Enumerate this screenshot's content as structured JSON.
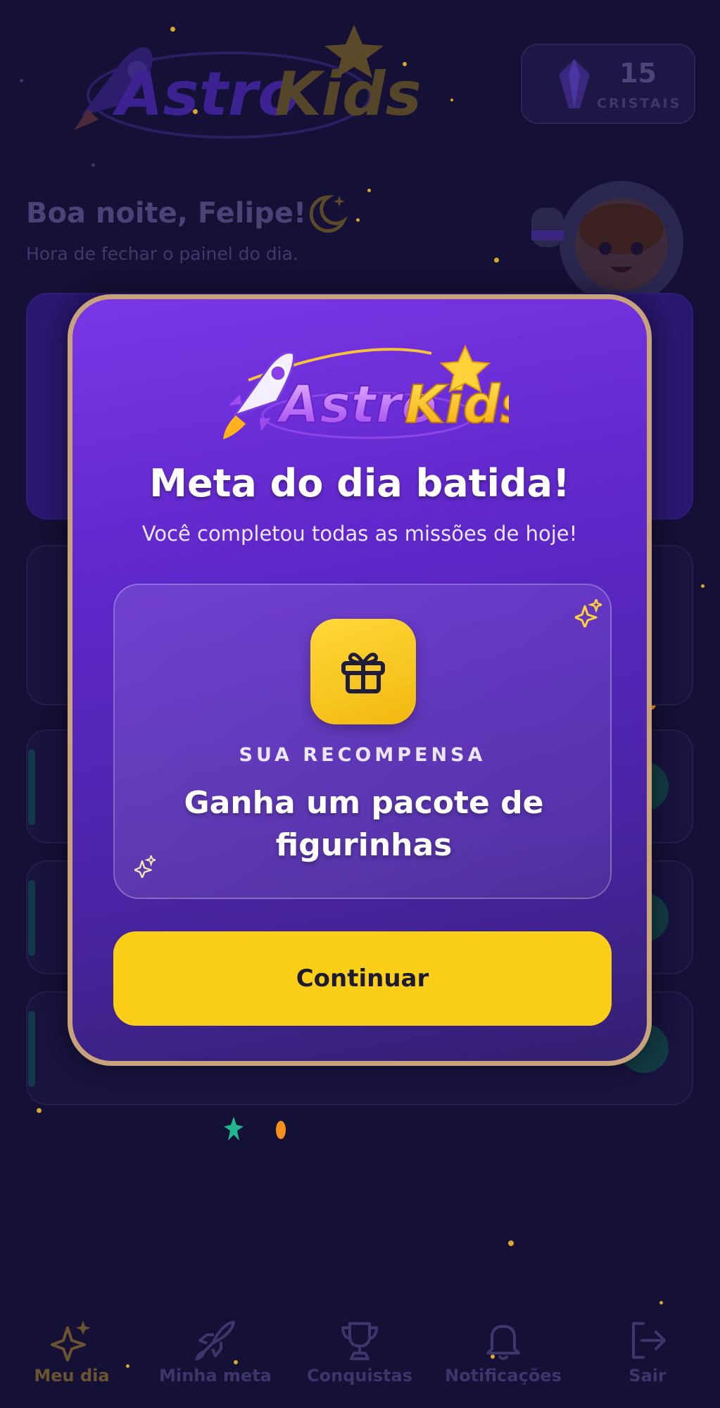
{
  "app": {
    "name": "AstroKids"
  },
  "header": {
    "crystals_count": "15",
    "crystals_label": "CRISTAIS"
  },
  "greeting": {
    "title": "Boa noite, Felipe!",
    "subtitle": "Hora de fechar o painel do dia."
  },
  "modal": {
    "title": "Meta do dia batida!",
    "subtitle": "Você completou todas as missões de hoje!",
    "reward_label": "SUA RECOMPENSA",
    "reward_text": "Ganha um pacote de figurinhas",
    "continue_label": "Continuar"
  },
  "nav": {
    "items": [
      {
        "label": "Meu dia",
        "icon": "sparkles-icon",
        "active": true
      },
      {
        "label": "Minha meta",
        "icon": "rocket-icon",
        "active": false
      },
      {
        "label": "Conquistas",
        "icon": "trophy-icon",
        "active": false
      },
      {
        "label": "Notificações",
        "icon": "bell-icon",
        "active": false
      },
      {
        "label": "Sair",
        "icon": "logout-icon",
        "active": false
      }
    ]
  },
  "colors": {
    "background": "#141036",
    "modal_top": "#7a36e6",
    "modal_border": "#c7a27a",
    "accent_yellow": "#fbcf17",
    "text_dark": "#1d1a33"
  }
}
